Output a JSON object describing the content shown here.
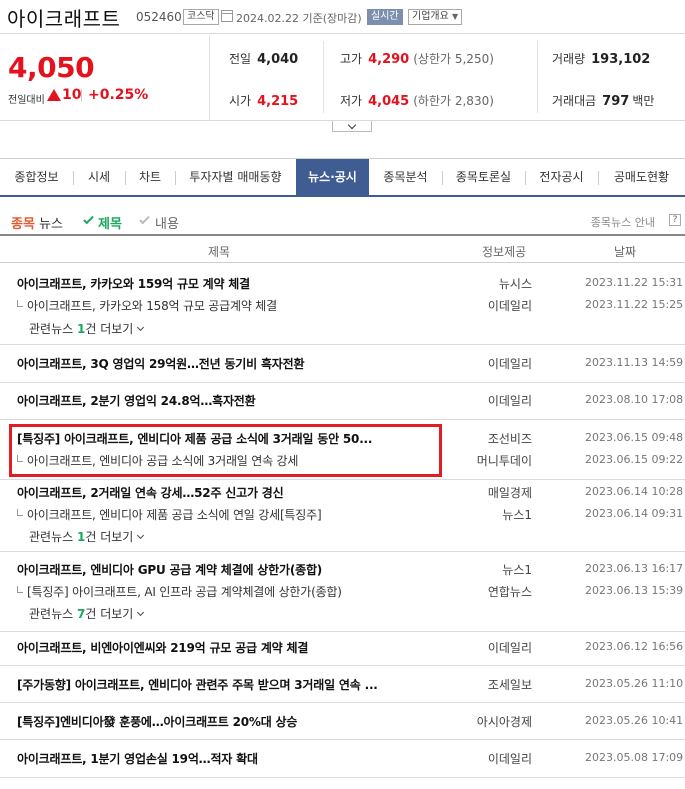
{
  "header": {
    "name": "아이크래프트",
    "code": "052460",
    "market_badge": "코스닥",
    "date": "2024.02.22",
    "date_note": "기준(장마감)",
    "live_btn": "실시간",
    "info_btn": "기업개요"
  },
  "price": {
    "current": "4,050",
    "change_label": "전일대비",
    "change": "10",
    "change_pct": "+0.25%",
    "prev_label": "전일",
    "prev": "4,040",
    "open_label": "시가",
    "open": "4,215",
    "high_label": "고가",
    "high": "4,290",
    "upper_label": "(상한가",
    "upper": "5,250)",
    "low_label": "저가",
    "low": "4,045",
    "lower_label": "(하한가",
    "lower": "2,830)",
    "volume_label": "거래량",
    "volume": "193,102",
    "amount_label": "거래대금",
    "amount": "797",
    "amount_unit": "백만"
  },
  "tabs": [
    {
      "label": "종합정보"
    },
    {
      "label": "시세"
    },
    {
      "label": "차트"
    },
    {
      "label": "투자자별 매매동향"
    },
    {
      "label": "뉴스·공시",
      "active": true
    },
    {
      "label": "종목분석"
    },
    {
      "label": "종목토론실"
    },
    {
      "label": "전자공시"
    },
    {
      "label": "공매도현황"
    }
  ],
  "filter": {
    "title_a": "종목",
    "title_b": "뉴스",
    "opt_title": "제목",
    "opt_content": "내용",
    "help": "종목뉴스 안내",
    "help_btn": "?"
  },
  "table_header": {
    "title": "제목",
    "source": "정보제공",
    "date": "날짜"
  },
  "news": [
    {
      "title": "아이크래프트, 카카오와 159억 규모 계약 체결",
      "source": "뉴시스",
      "date": "2023.11.22 15:31",
      "related": {
        "title": "아이크래프트, 카카오와 158억 규모 공급계약 체결",
        "source": "이데일리",
        "date": "2023.11.22 15:25"
      },
      "more": {
        "prefix": "관련뉴스 ",
        "count": "1",
        "suffix": "건 더보기"
      }
    },
    {
      "title": "아이크래프트, 3Q 영업익 29억원…전년 동기비 흑자전환",
      "source": "이데일리",
      "date": "2023.11.13 14:59"
    },
    {
      "title": "아이크래프트, 2분기 영업익 24.8억…흑자전환",
      "source": "이데일리",
      "date": "2023.08.10 17:08"
    },
    {
      "title": "[특징주] 아이크래프트, 엔비디아 제품 공급 소식에 3거래일 동안 50...",
      "source": "조선비즈",
      "date": "2023.06.15 09:48",
      "related": {
        "title": "아이크래프트, 엔비디아 공급 소식에 3거래일 연속 강세",
        "source": "머니투데이",
        "date": "2023.06.15 09:22"
      }
    },
    {
      "title": "아이크래프트, 2거래일 연속 강세…52주 신고가 경신",
      "source": "매일경제",
      "date": "2023.06.14 10:28",
      "related": {
        "title": "아이크래프트, 엔비디아 제품 공급 소식에 연일 강세[특징주]",
        "source": "뉴스1",
        "date": "2023.06.14 09:31"
      },
      "more": {
        "prefix": "관련뉴스 ",
        "count": "1",
        "suffix": "건 더보기"
      }
    },
    {
      "title": "아이크래프트, 엔비디아 GPU 공급 계약 체결에 상한가(종합)",
      "source": "뉴스1",
      "date": "2023.06.13 16:17",
      "related": {
        "title": "[특징주] 아이크래프트, AI 인프라 공급 계약체결에 상한가(종합)",
        "source": "연합뉴스",
        "date": "2023.06.13 15:39"
      },
      "more": {
        "prefix": "관련뉴스 ",
        "count": "7",
        "suffix": "건 더보기"
      }
    },
    {
      "title": "아이크래프트, 비엔아이엔씨와 219억 규모 공급 계약 체결",
      "source": "이데일리",
      "date": "2023.06.12 16:56"
    },
    {
      "title": "[주가동향] 아이크래프트, 엔비디아 관련주 주목 받으며 3거래일 연속 ...",
      "source": "조세일보",
      "date": "2023.05.26 11:10"
    },
    {
      "title": "[특징주]엔비디아發 훈풍에…아이크래프트 20%대 상승",
      "source": "아시아경제",
      "date": "2023.05.26 10:41"
    },
    {
      "title": "아이크래프트, 1분기 영업손실 19억…적자 확대",
      "source": "이데일리",
      "date": "2023.05.08 17:09"
    }
  ]
}
